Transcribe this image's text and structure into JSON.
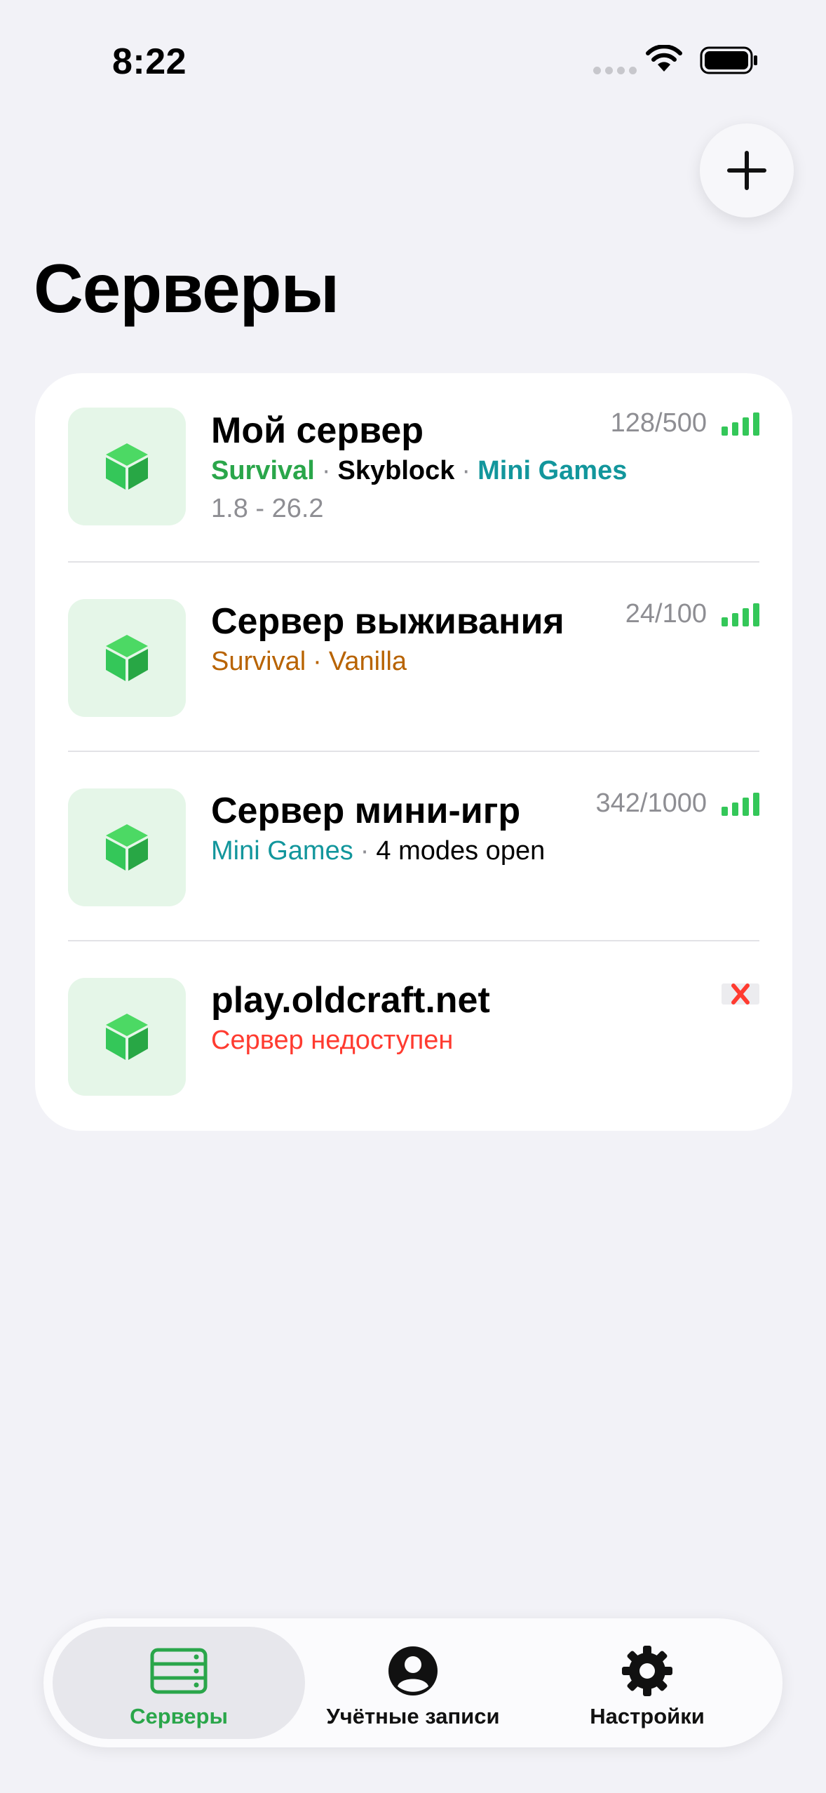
{
  "status_bar": {
    "time": "8:22"
  },
  "header": {
    "title": "Серверы",
    "add_button_icon": "plus-icon"
  },
  "colors": {
    "accent_green": "#34c759",
    "tag_green": "#2aa64a",
    "tag_teal": "#12969c",
    "tag_orange": "#b86300",
    "error_red": "#ff3b30",
    "tile_background": "#e5f6e8"
  },
  "servers": [
    {
      "name": "Мой сервер",
      "players": "128/500",
      "tags": [
        {
          "text": "Survival",
          "style": "green"
        },
        {
          "text": "Skyblock",
          "style": "black"
        },
        {
          "text": "Mini Games",
          "style": "teal"
        }
      ],
      "version": "1.8 - 26.2",
      "status": "online",
      "icon": "cube-icon"
    },
    {
      "name": "Сервер выживания",
      "players": "24/100",
      "tags": [
        {
          "text": "Survival",
          "style": "orange"
        },
        {
          "text": "Vanilla",
          "style": "orange"
        }
      ],
      "status": "online",
      "icon": "cube-icon"
    },
    {
      "name": "Сервер мини-игр",
      "players": "342/1000",
      "tags": [
        {
          "text": "Mini Games",
          "style": "teal"
        },
        {
          "text": "4 modes open",
          "style": "plain"
        }
      ],
      "status": "online",
      "icon": "cube-icon"
    },
    {
      "name": "play.oldcraft.net",
      "status_text": "Сервер недоступен",
      "status": "offline",
      "icon": "cube-icon"
    }
  ],
  "tabbar": {
    "items": [
      {
        "label": "Серверы",
        "icon": "server-rack-icon",
        "active": true
      },
      {
        "label": "Учётные записи",
        "icon": "person-circle-icon",
        "active": false
      },
      {
        "label": "Настройки",
        "icon": "gear-icon",
        "active": false
      }
    ]
  }
}
